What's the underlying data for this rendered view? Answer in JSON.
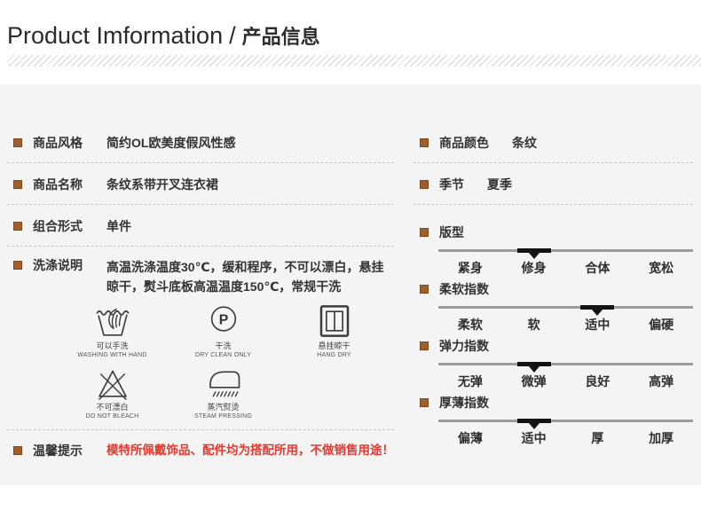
{
  "header": {
    "title_en": "Product Imformation",
    "title_separator": "/",
    "title_zh": "产品信息"
  },
  "left": {
    "rows": [
      {
        "label": "商品风格",
        "value": "简约OL欧美度假风性感"
      },
      {
        "label": "商品名称",
        "value": "条纹系带开叉连衣裙"
      },
      {
        "label": "组合形式",
        "value": "单件"
      }
    ],
    "washing": {
      "label": "洗涤说明",
      "description": "高温洗涤温度30℃，缓和程序，不可以漂白，悬挂晾干，熨斗底板高温温度150℃，常规干洗",
      "icons": [
        {
          "name": "hand-wash-icon",
          "zh": "可以手洗",
          "en": "WASHING WITH HAND"
        },
        {
          "name": "dry-clean-icon",
          "zh": "干洗",
          "en": "DRY CLEAN ONLY"
        },
        {
          "name": "hang-dry-icon",
          "zh": "悬挂晾干",
          "en": "HANG DRY"
        },
        {
          "name": "no-bleach-icon",
          "zh": "不可漂白",
          "en": "DO NOT BLEACH"
        },
        {
          "name": "steam-press-icon",
          "zh": "蒸汽熨烫",
          "en": "STEAM PRESSING"
        }
      ]
    },
    "tips": {
      "label": "温馨提示",
      "value": "模特所佩戴饰品、配件均为搭配所用，不做销售用途！"
    }
  },
  "right": {
    "rows": [
      {
        "label": "商品颜色",
        "value": "条纹"
      },
      {
        "label": "季节",
        "value": "夏季"
      }
    ],
    "sliders": [
      {
        "label": "版型",
        "options": [
          "紧身",
          "修身",
          "合体",
          "宽松"
        ],
        "selected": 1
      },
      {
        "label": "柔软指数",
        "options": [
          "柔软",
          "软",
          "适中",
          "偏硬"
        ],
        "selected": 2
      },
      {
        "label": "弹力指数",
        "options": [
          "无弹",
          "微弹",
          "良好",
          "高弹"
        ],
        "selected": 1
      },
      {
        "label": "厚薄指数",
        "options": [
          "偏薄",
          "适中",
          "厚",
          "加厚"
        ],
        "selected": 1
      }
    ]
  },
  "colors": {
    "panel_bg": "#f4f4f4",
    "text": "#333333",
    "bullet": "#a25e2a",
    "tip_red": "#e4392e",
    "slider_track": "#9c9c9c",
    "slider_indicator": "#141414",
    "dashed_divider": "#c9c9c9"
  }
}
